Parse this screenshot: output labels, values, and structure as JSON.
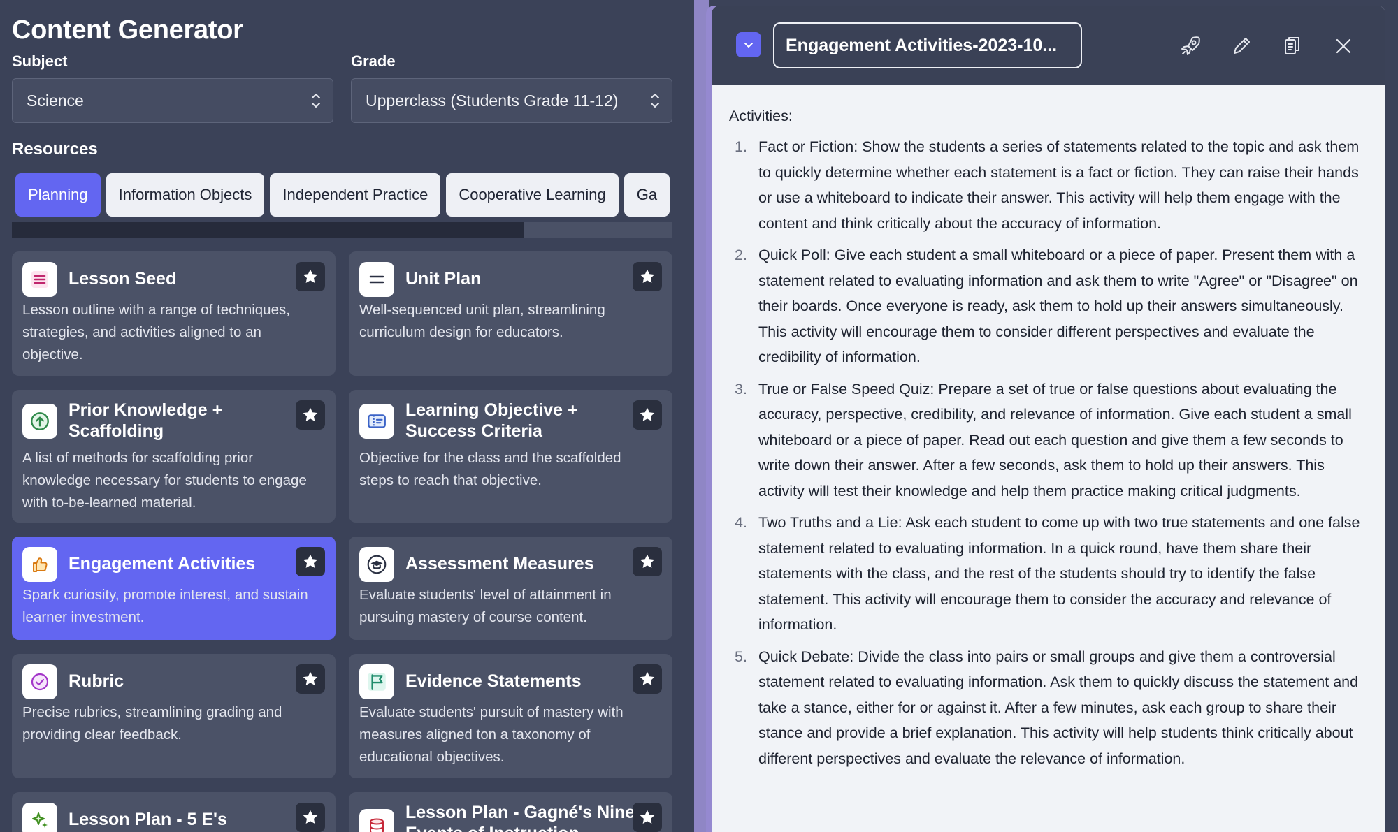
{
  "app": {
    "title": "Content Generator"
  },
  "filters": {
    "subject_label": "Subject",
    "subject_value": "Science",
    "grade_label": "Grade",
    "grade_value": "Upperclass (Students Grade 11-12)"
  },
  "resources": {
    "title": "Resources",
    "tabs": [
      "Planning",
      "Information Objects",
      "Independent Practice",
      "Cooperative Learning",
      "Ga"
    ],
    "active_tab": "Planning"
  },
  "cards": [
    {
      "title": "Lesson Seed",
      "desc": "Lesson outline with a range of techniques, strategies, and activities aligned to an objective.",
      "icon": "list-icon"
    },
    {
      "title": "Unit Plan",
      "desc": "Well-sequenced unit plan, streamlining curriculum design for educators.",
      "icon": "equals-icon"
    },
    {
      "title": "Prior Knowledge + Scaffolding",
      "desc": "A list of methods for scaffolding prior knowledge necessary for students to engage with to-be-learned material.",
      "icon": "arrow-up-circle-icon"
    },
    {
      "title": "Learning Objective + Success Criteria",
      "desc": "Objective for the class and the scaffolded steps to reach that objective.",
      "icon": "ticket-icon"
    },
    {
      "title": "Engagement Activities",
      "desc": "Spark curiosity, promote interest, and sustain learner investment.",
      "icon": "thumbs-up-icon",
      "active": true
    },
    {
      "title": "Assessment Measures",
      "desc": "Evaluate students' level of attainment in pursuing mastery of course content.",
      "icon": "graduation-cap-icon"
    },
    {
      "title": "Rubric",
      "desc": "Precise rubrics, streamlining grading and providing clear feedback.",
      "icon": "check-circle-icon"
    },
    {
      "title": "Evidence Statements",
      "desc": "Evaluate students' pursuit of mastery with measures aligned ton a taxonomy of educational objectives.",
      "icon": "flag-icon"
    },
    {
      "title": "Lesson Plan - 5 E's",
      "desc": "",
      "icon": "sparkle-icon"
    },
    {
      "title": "Lesson Plan - Gagné's Nine Events of Instruction",
      "desc": "",
      "icon": "database-icon"
    }
  ],
  "document": {
    "title": "Engagement Activities-2023-10...",
    "heading": "Activities:",
    "items": [
      "Fact or Fiction: Show the students a series of statements related to the topic and ask them to quickly determine whether each statement is a fact or fiction. They can raise their hands or use a whiteboard to indicate their answer. This activity will help them engage with the content and think critically about the accuracy of information.",
      "Quick Poll: Give each student a small whiteboard or a piece of paper. Present them with a statement related to evaluating information and ask them to write \"Agree\" or \"Disagree\" on their boards. Once everyone is ready, ask them to hold up their answers simultaneously. This activity will encourage them to consider different perspectives and evaluate the credibility of information.",
      "True or False Speed Quiz: Prepare a set of true or false questions about evaluating the accuracy, perspective, credibility, and relevance of information. Give each student a small whiteboard or a piece of paper. Read out each question and give them a few seconds to write down their answer. After a few seconds, ask them to hold up their answers. This activity will test their knowledge and help them practice making critical judgments.",
      "Two Truths and a Lie: Ask each student to come up with two true statements and one false statement related to evaluating information. In a quick round, have them share their statements with the class, and the rest of the students should try to identify the false statement. This activity will encourage them to consider the accuracy and relevance of information.",
      "Quick Debate: Divide the class into pairs or small groups and give them a controversial statement related to evaluating information. Ask them to quickly discuss the statement and take a stance, either for or against it. After a few minutes, ask each group to share their stance and provide a brief explanation. This activity will help students think critically about different perspectives and evaluate the relevance of information."
    ],
    "numbers": [
      "1.",
      "2.",
      "3.",
      "4.",
      "5."
    ]
  },
  "colors": {
    "accent": "#6366f1",
    "panel": "#3b4258",
    "card": "#4b5267",
    "doc_bg": "#f1f3f7"
  }
}
